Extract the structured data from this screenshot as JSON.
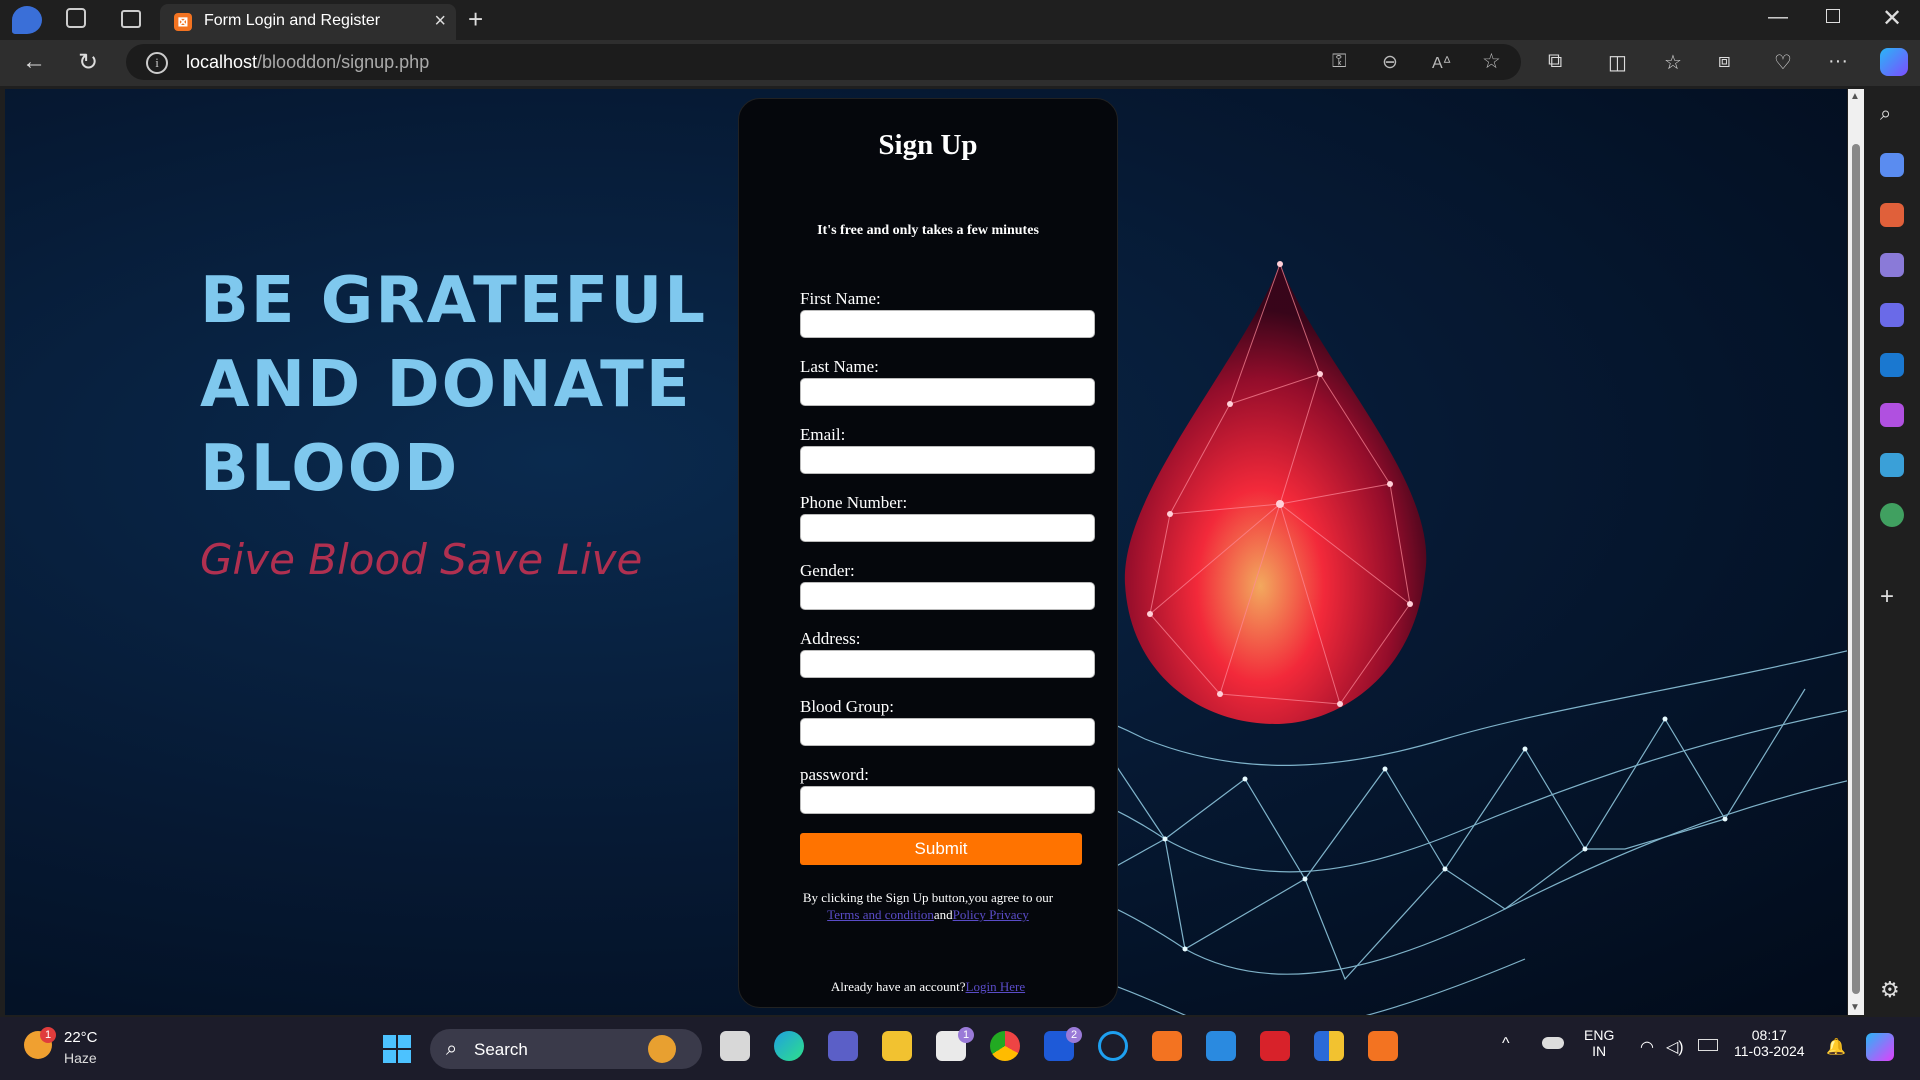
{
  "browser": {
    "tab_title": "Form Login and Register",
    "url_host": "localhost",
    "url_path": "/blooddon/signup.php"
  },
  "hero": {
    "title_line1": "BE GRATEFUL",
    "title_line2": "AND DONATE",
    "title_line3": "BLOOD",
    "subtitle": "Give Blood  Save Live"
  },
  "form": {
    "heading": "Sign Up",
    "tagline": "It's free and only takes a few minutes",
    "fields": [
      {
        "label": "First Name:",
        "value": ""
      },
      {
        "label": "Last Name:",
        "value": ""
      },
      {
        "label": "Email:",
        "value": ""
      },
      {
        "label": "Phone Number:",
        "value": ""
      },
      {
        "label": "Gender:",
        "value": ""
      },
      {
        "label": "Address:",
        "value": ""
      },
      {
        "label": "Blood Group:",
        "value": ""
      },
      {
        "label": "password:",
        "value": ""
      }
    ],
    "submit_label": "Submit",
    "terms_prefix": "By clicking the Sign Up button,you agree to our",
    "terms_link": "Terms and condition",
    "terms_and": "and",
    "privacy_link": "Policy Privacy",
    "login_prompt": "Already have an account?",
    "login_link": "Login Here"
  },
  "taskbar": {
    "temperature": "22°C",
    "weather": "Haze",
    "weather_badge": "1",
    "search_label": "Search",
    "lang_line1": "ENG",
    "lang_line2": "IN",
    "time": "08:17",
    "date": "11-03-2024",
    "store_badge": "1",
    "app_badge": "2"
  },
  "colors": {
    "submit": "#ff7300",
    "hero_title": "#7fc8ee",
    "hero_subtitle": "#b03050",
    "link": "#5a4cc8"
  }
}
